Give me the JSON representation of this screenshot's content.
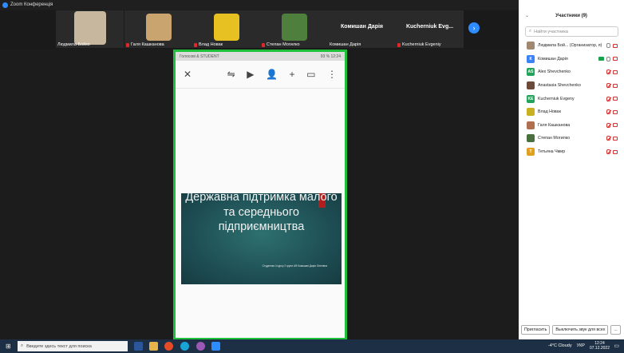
{
  "window": {
    "title": "Zoom Конференція",
    "controls": [
      "–",
      "❐",
      "✕"
    ]
  },
  "thumbnails": [
    {
      "name": "Людмила Бойко",
      "muted": false,
      "color": "#b8a48a"
    },
    {
      "name": "Галя Кашканова",
      "muted": true,
      "color": "#c9a46f"
    },
    {
      "name": "Влад Новак",
      "muted": true,
      "color": "#e7c021"
    },
    {
      "name": "Степан Могилко",
      "muted": true,
      "color": "#4f7f3c"
    },
    {
      "name": "Комишан Дарія",
      "muted": false,
      "big": "Комишан Дарія"
    },
    {
      "name": "Kucherniuk Evgeniy",
      "muted": true,
      "big": "Kucherniuk  Evg..."
    }
  ],
  "share": {
    "status_left": "Голосові & STUDENT",
    "status_right": "93 %  12:24",
    "slide_title": "Державна підтримка малого та середнього підприємництва",
    "slide_sub": "Студентки 4 курсу 2 групи АФ Комишан Дарія Олегівна"
  },
  "panel": {
    "title": "Участники (9)",
    "search_placeholder": "Найти участника",
    "participants": [
      {
        "name": "Людмила Бой... (Организатор, я)",
        "avatar": "",
        "color": "#a08770",
        "state": "normal"
      },
      {
        "name": "Комишан Дарія",
        "avatar": "К",
        "color": "#3b82f6",
        "state": "video"
      },
      {
        "name": "Alex Shevchenko",
        "avatar": "AS",
        "color": "#22a35a",
        "state": "muted"
      },
      {
        "name": "Anastasia Shevchenko",
        "avatar": "",
        "color": "#6b4a3a",
        "state": "muted"
      },
      {
        "name": "Kucherniuk Evgeny",
        "avatar": "KE",
        "color": "#22a35a",
        "state": "muted"
      },
      {
        "name": "Влад Новак",
        "avatar": "",
        "color": "#c9b020",
        "state": "muted"
      },
      {
        "name": "Галя Кашканова",
        "avatar": "",
        "color": "#b07050",
        "state": "muted"
      },
      {
        "name": "Степан Могилко",
        "avatar": "",
        "color": "#4a7040",
        "state": "muted"
      },
      {
        "name": "Тетьяна Чмир",
        "avatar": "Т",
        "color": "#e0a020",
        "state": "muted"
      }
    ],
    "invite_label": "Пригласить",
    "mute_all_label": "Выключить звук для всех",
    "more_label": "..."
  },
  "taskbar": {
    "search_placeholder": "Введите здесь текст для поиска",
    "weather": "-4°C  Cloudy",
    "lang": "УКР",
    "time": "12:24",
    "date": "07.12.2022"
  }
}
